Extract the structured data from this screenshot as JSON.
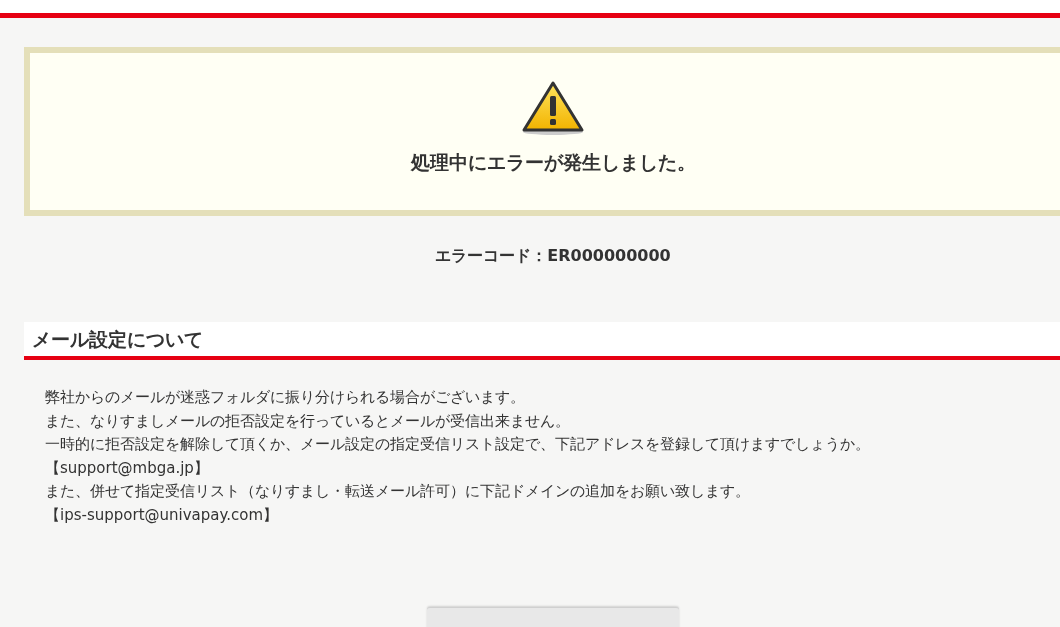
{
  "error_box": {
    "message": "処理中にエラーが発生しました。"
  },
  "error_code": "エラーコード：ER000000000",
  "section": {
    "heading": "メール設定について",
    "lines": [
      "弊社からのメールが迷惑フォルダに振り分けられる場合がございます。",
      "また、なりすましメールの拒否設定を行っているとメールが受信出来ません。",
      "一時的に拒否設定を解除して頂くか、メール設定の指定受信リスト設定で、下記アドレスを登録して頂けますでしょうか。",
      "【support@mbga.jp】",
      "また、併せて指定受信リスト（なりすまし・転送メール許可）に下記ドメインの追加をお願い致します。",
      "【ips-support@univapay.com】"
    ]
  }
}
